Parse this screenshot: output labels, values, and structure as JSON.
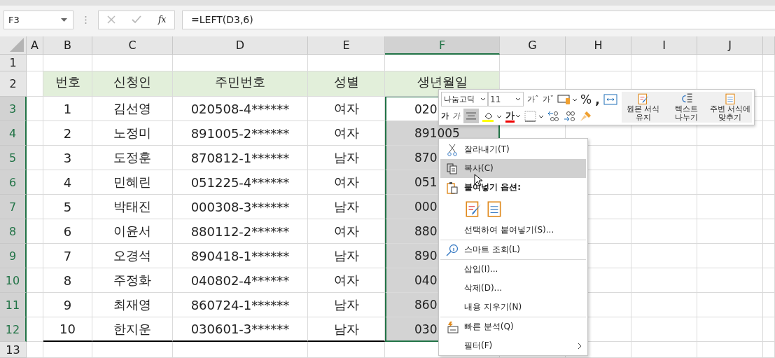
{
  "name_box": "F3",
  "function_label": "fx",
  "formula": "=LEFT(D3,6)",
  "column_headers": [
    {
      "label": "A",
      "selected": false
    },
    {
      "label": "B",
      "selected": false
    },
    {
      "label": "C",
      "selected": false
    },
    {
      "label": "D",
      "selected": false
    },
    {
      "label": "E",
      "selected": false
    },
    {
      "label": "F",
      "selected": true
    },
    {
      "label": "G",
      "selected": false
    },
    {
      "label": "H",
      "selected": false
    },
    {
      "label": "I",
      "selected": false
    },
    {
      "label": "J",
      "selected": false
    }
  ],
  "row_headers": [
    {
      "label": "1",
      "selected": false
    },
    {
      "label": "2",
      "selected": false
    },
    {
      "label": "3",
      "selected": true
    },
    {
      "label": "4",
      "selected": true
    },
    {
      "label": "5",
      "selected": true
    },
    {
      "label": "6",
      "selected": true
    },
    {
      "label": "7",
      "selected": true
    },
    {
      "label": "8",
      "selected": true
    },
    {
      "label": "9",
      "selected": true
    },
    {
      "label": "10",
      "selected": true
    },
    {
      "label": "11",
      "selected": true
    },
    {
      "label": "12",
      "selected": true
    },
    {
      "label": "13",
      "selected": false
    }
  ],
  "table": {
    "columns": [
      "번호",
      "신청인",
      "주민번호",
      "성별",
      "생년월일"
    ],
    "rows": [
      {
        "cells": [
          "1",
          "김선영",
          "020508-4******",
          "여자",
          "020"
        ],
        "selected": true,
        "active": true
      },
      {
        "cells": [
          "2",
          "노정미",
          "891005-2******",
          "여자",
          "891005"
        ],
        "selected": true,
        "active": false
      },
      {
        "cells": [
          "3",
          "도정훈",
          "870812-1******",
          "남자",
          "870"
        ],
        "selected": true,
        "active": false
      },
      {
        "cells": [
          "4",
          "민혜린",
          "051225-4******",
          "여자",
          "051"
        ],
        "selected": true,
        "active": false
      },
      {
        "cells": [
          "5",
          "박태진",
          "000308-3******",
          "남자",
          "000"
        ],
        "selected": true,
        "active": false
      },
      {
        "cells": [
          "6",
          "이윤서",
          "880112-2******",
          "여자",
          "880"
        ],
        "selected": true,
        "active": false
      },
      {
        "cells": [
          "7",
          "오경석",
          "890418-1******",
          "남자",
          "890"
        ],
        "selected": true,
        "active": false
      },
      {
        "cells": [
          "8",
          "주정화",
          "040802-4******",
          "여자",
          "040"
        ],
        "selected": true,
        "active": false
      },
      {
        "cells": [
          "9",
          "최재영",
          "860724-1******",
          "남자",
          "860"
        ],
        "selected": true,
        "active": false
      },
      {
        "cells": [
          "10",
          "한지운",
          "030601-3******",
          "남자",
          "030"
        ],
        "selected": true,
        "active": false
      }
    ]
  },
  "mini_toolbar": {
    "font": "나눔고딕",
    "size": "11",
    "grow_font": "가ˆ",
    "shrink_font": "가ˇ",
    "percent": "%",
    "comma": ",",
    "bold": "가",
    "italic": "가",
    "align_center": {
      "selected": true
    },
    "font_color": "가",
    "paste_buttons": [
      "원본 서식 유지",
      "텍스트 나누기",
      "주변 서식에 맞추기"
    ]
  },
  "context_menu": [
    {
      "kind": "item",
      "label": "잘라내기(T)",
      "selected": false,
      "separator_before": false
    },
    {
      "kind": "item",
      "label": "복사(C)",
      "selected": true,
      "separator_before": false
    },
    {
      "kind": "header",
      "label": "붙여넣기 옵션:",
      "separator_before": false
    },
    {
      "kind": "paste_options"
    },
    {
      "kind": "item",
      "label": "선택하여 붙여넣기(S)...",
      "selected": false,
      "separator_before": false
    },
    {
      "kind": "item",
      "label": "스마트 조회(L)",
      "selected": false,
      "separator_before": true
    },
    {
      "kind": "item",
      "label": "삽입(I)...",
      "selected": false,
      "separator_before": true
    },
    {
      "kind": "item",
      "label": "삭제(D)...",
      "selected": false,
      "separator_before": false
    },
    {
      "kind": "item",
      "label": "내용 지우기(N)",
      "selected": false,
      "separator_before": false
    },
    {
      "kind": "item",
      "label": "빠른 분석(Q)",
      "selected": false,
      "separator_before": true
    },
    {
      "kind": "submenu",
      "label": "필터(F)",
      "selected": false,
      "separator_before": false
    }
  ]
}
